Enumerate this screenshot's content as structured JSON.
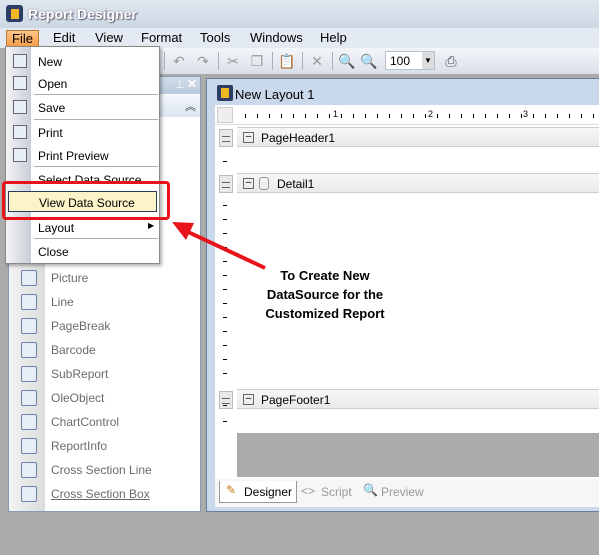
{
  "app": {
    "title": "Report Designer"
  },
  "menubar": [
    "File",
    "Edit",
    "View",
    "Format",
    "Tools",
    "Windows",
    "Help"
  ],
  "toolbar": {
    "zoom_value": "100"
  },
  "file_menu": {
    "items": [
      {
        "label": "New",
        "icon": "new-file-icon"
      },
      {
        "label": "Open",
        "icon": "open-folder-icon"
      },
      {
        "label": "Save",
        "icon": "save-icon"
      },
      {
        "label": "Print",
        "icon": "print-icon"
      },
      {
        "label": "Print Preview",
        "icon": "print-preview-icon"
      },
      {
        "label": "Select Data Source"
      },
      {
        "label": "View Data Source",
        "highlighted": true
      },
      {
        "label": "Layout",
        "submenu": true
      },
      {
        "label": "Close"
      }
    ]
  },
  "toolbox": {
    "items": [
      "Picture",
      "Line",
      "PageBreak",
      "Barcode",
      "SubReport",
      "OleObject",
      "ChartControl",
      "ReportInfo",
      "Cross Section Line",
      "Cross Section Box"
    ]
  },
  "document": {
    "title": "New Layout 1",
    "ruler": [
      "1",
      "2",
      "3"
    ],
    "bands": [
      "PageHeader1",
      "Detail1",
      "PageFooter1"
    ],
    "tabs": [
      "Designer",
      "Script",
      "Preview"
    ],
    "active_tab": "Designer"
  },
  "annotation": {
    "lines": [
      "To Create New",
      "DataSource for the",
      "Customized Report"
    ],
    "color": "#e8131b"
  }
}
